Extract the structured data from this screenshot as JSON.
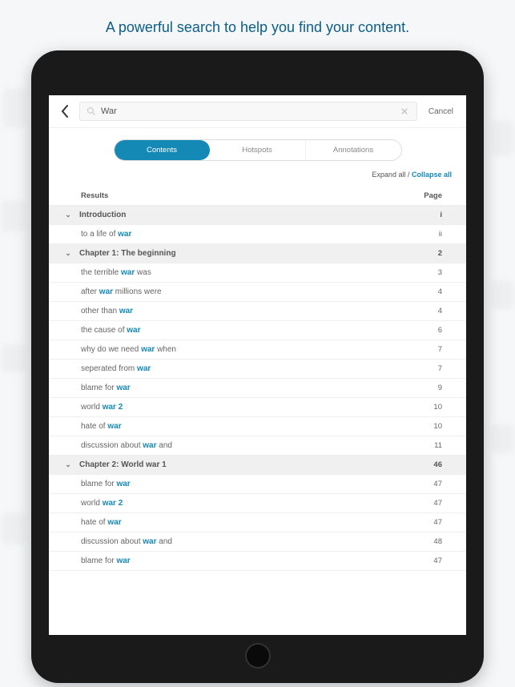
{
  "caption": "A powerful search to help you find your content.",
  "search": {
    "value": "War",
    "cancel": "Cancel"
  },
  "segments": {
    "contents": "Contents",
    "hotspots": "Hotspots",
    "annotations": "Annotations"
  },
  "expand": {
    "expand_all": "Expand all",
    "sep": " / ",
    "collapse_all": "Collapse all"
  },
  "headers": {
    "results": "Results",
    "page": "Page"
  },
  "sections": [
    {
      "title": "Introduction",
      "page": "i",
      "items": [
        {
          "pre": "to a life of ",
          "hl": "war",
          "post": "",
          "page": "ii"
        }
      ]
    },
    {
      "title": "Chapter 1: The beginning",
      "page": "2",
      "items": [
        {
          "pre": "the terrible ",
          "hl": "war",
          "post": " was",
          "page": "3"
        },
        {
          "pre": "after ",
          "hl": "war",
          "post": " millions were",
          "page": "4"
        },
        {
          "pre": "other than ",
          "hl": "war",
          "post": "",
          "page": "4"
        },
        {
          "pre": "the cause of ",
          "hl": "war",
          "post": "",
          "page": "6"
        },
        {
          "pre": "why do we need ",
          "hl": "war",
          "post": " when",
          "page": "7"
        },
        {
          "pre": "seperated from ",
          "hl": "war",
          "post": "",
          "page": "7"
        },
        {
          "pre": "blame for ",
          "hl": "war",
          "post": "",
          "page": "9"
        },
        {
          "pre": "world ",
          "hl": "war 2",
          "post": "",
          "page": "10"
        },
        {
          "pre": "hate of ",
          "hl": "war",
          "post": "",
          "page": "10"
        },
        {
          "pre": "discussion about ",
          "hl": "war",
          "post": " and",
          "page": "11"
        }
      ]
    },
    {
      "title": "Chapter 2: World war 1",
      "page": "46",
      "items": [
        {
          "pre": "blame for ",
          "hl": "war",
          "post": "",
          "page": "47"
        },
        {
          "pre": "world ",
          "hl": "war 2",
          "post": "",
          "page": "47"
        },
        {
          "pre": "hate of ",
          "hl": "war",
          "post": "",
          "page": "47"
        },
        {
          "pre": "discussion about ",
          "hl": "war",
          "post": " and",
          "page": "48"
        },
        {
          "pre": "blame for ",
          "hl": "war",
          "post": "",
          "page": "47"
        }
      ]
    }
  ]
}
